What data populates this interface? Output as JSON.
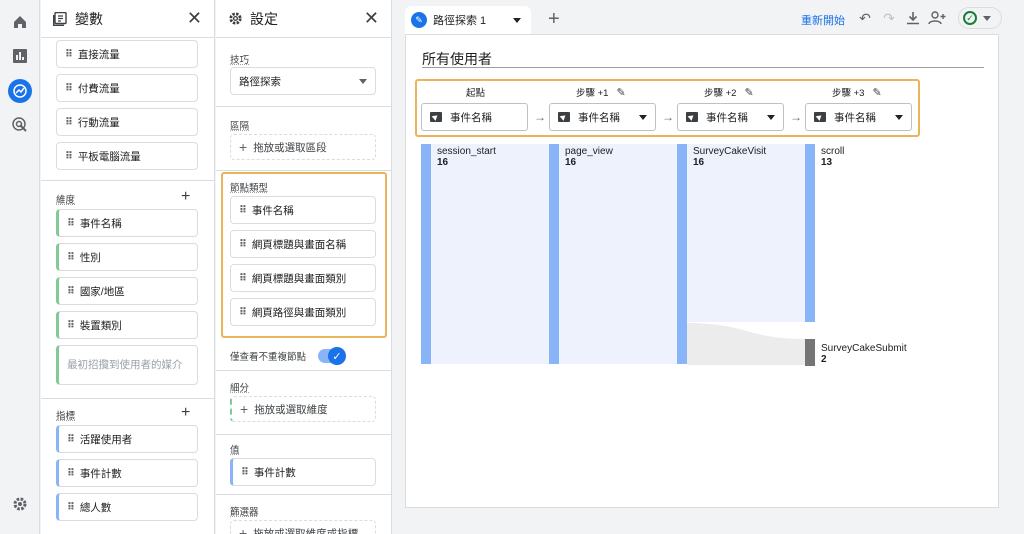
{
  "rail": {
    "icons": [
      "home-icon",
      "bar-chart-icon",
      "explore-icon",
      "advertising-icon",
      "settings-icon"
    ]
  },
  "variables": {
    "title": "變數",
    "segments": [
      "直接流量",
      "付費流量",
      "行動流量",
      "平板電腦流量"
    ],
    "dimensions_label": "維度",
    "dimensions": [
      "事件名稱",
      "性別",
      "國家/地區",
      "裝置類別"
    ],
    "dimension_placeholder": "最初招攬到使用者的媒介",
    "metrics_label": "指標",
    "metrics": [
      "活躍使用者",
      "事件計數",
      "總人數"
    ]
  },
  "settings": {
    "title": "設定",
    "technique_label": "技巧",
    "technique_value": "路徑探索",
    "segment_label": "區隔",
    "segment_drop": "拖放或選取區段",
    "node_type_label": "節點類型",
    "node_types": [
      "事件名稱",
      "網頁標題與畫面名稱",
      "網頁標題與畫面類別",
      "網頁路徑與畫面類別"
    ],
    "unique_nodes_label": "僅查看不重複節點",
    "breakdown_label": "細分",
    "breakdown_drop": "拖放或選取維度",
    "values_label": "值",
    "values_value": "事件計數",
    "filters_label": "篩選器",
    "filters_drop": "拖放或選取維度或指標"
  },
  "toolbar": {
    "tab_label": "路徑探索 1",
    "reset_label": "重新開始"
  },
  "canvas": {
    "segment_title": "所有使用者",
    "steps": [
      {
        "label": "起點",
        "node_type": "事件名稱"
      },
      {
        "label": "步驟 +1",
        "node_type": "事件名稱"
      },
      {
        "label": "步驟 +2",
        "node_type": "事件名稱"
      },
      {
        "label": "步驟 +3",
        "node_type": "事件名稱"
      }
    ],
    "nodes": [
      {
        "name": "session_start",
        "count": "16"
      },
      {
        "name": "page_view",
        "count": "16"
      },
      {
        "name": "SurveyCakeVisit",
        "count": "16"
      },
      {
        "name": "scroll",
        "count": "13"
      },
      {
        "name": "SurveyCakeSubmit",
        "count": "2"
      }
    ]
  },
  "colors": {
    "accent": "#1a73e8",
    "highlight": "#e8b55b",
    "node_bar": "#8ab4f8",
    "flow": "#e8eefb",
    "exit_bar": "#757575"
  }
}
